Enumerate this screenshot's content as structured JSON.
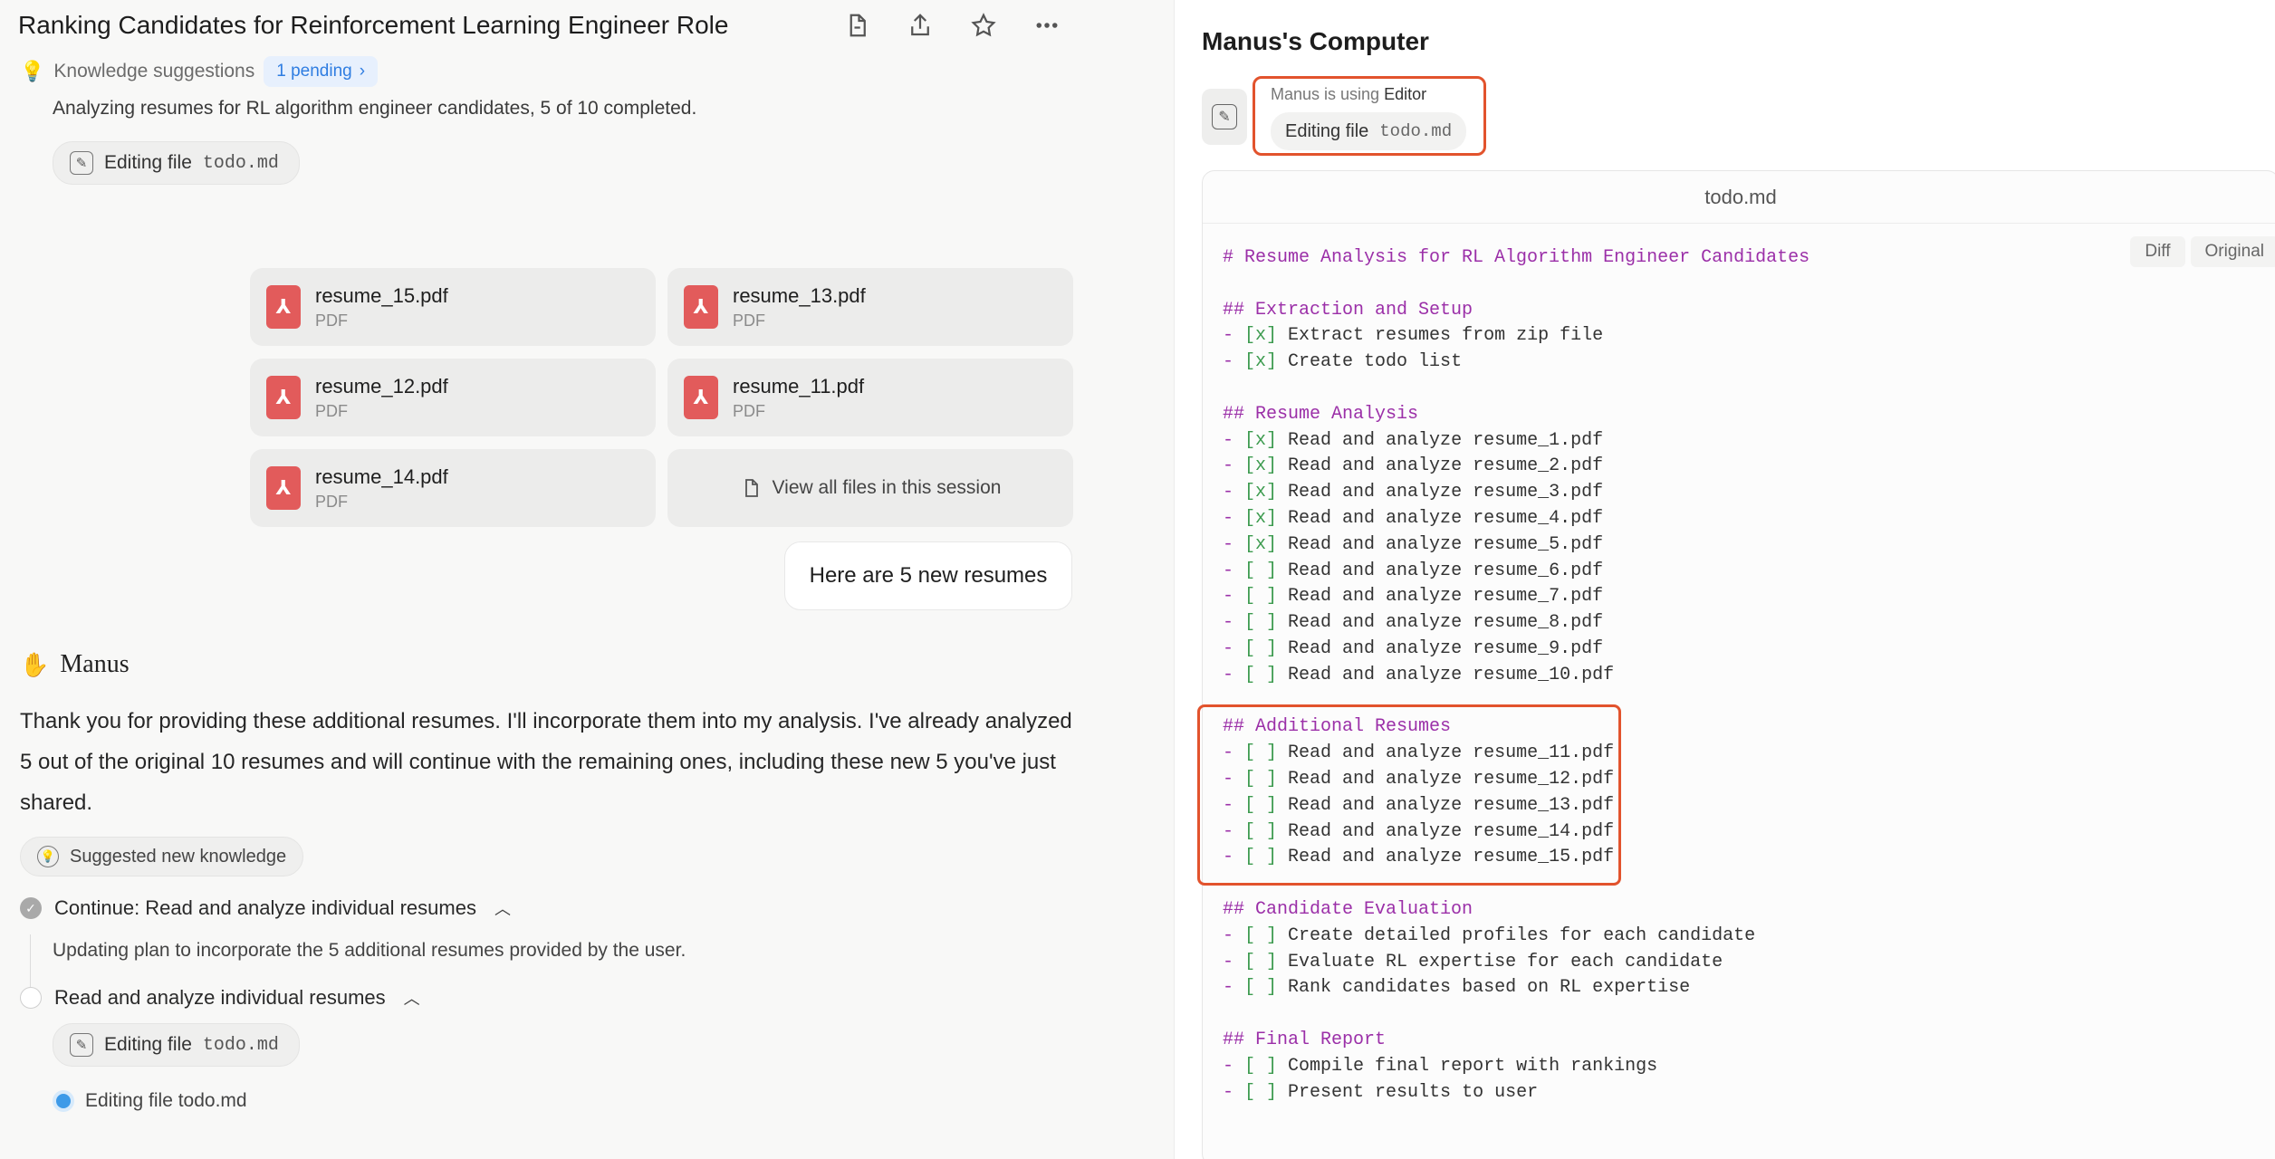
{
  "header": {
    "title": "Ranking Candidates for Reinforcement Learning Engineer Role"
  },
  "knowledge": {
    "label": "Knowledge suggestions",
    "pending": "1 pending"
  },
  "status": "Analyzing resumes for RL algorithm engineer candidates, 5 of 10 completed.",
  "edit_chip_1": {
    "label": "Editing file",
    "file": "todo.md"
  },
  "files": [
    {
      "name": "resume_15.pdf",
      "type": "PDF"
    },
    {
      "name": "resume_13.pdf",
      "type": "PDF"
    },
    {
      "name": "resume_12.pdf",
      "type": "PDF"
    },
    {
      "name": "resume_11.pdf",
      "type": "PDF"
    },
    {
      "name": "resume_14.pdf",
      "type": "PDF"
    }
  ],
  "view_all_label": "View all files in this session",
  "user_message": "Here are 5 new resumes",
  "agent": {
    "name": "Manus",
    "message": "Thank you for providing these additional resumes. I'll incorporate them into my analysis. I've already analyzed 5 out of the original 10 resumes and will continue with the remaining ones, including these new 5 you've just shared.",
    "suggest_label": "Suggested new knowledge"
  },
  "steps": {
    "step1": {
      "label": "Continue: Read and analyze individual resumes",
      "detail": "Updating plan to incorporate the 5 additional resumes provided by the user."
    },
    "step2": {
      "label": "Read and analyze individual resumes"
    },
    "edit_chip_2": {
      "label": "Editing file",
      "file": "todo.md"
    },
    "live": "Editing file todo.md"
  },
  "computer": {
    "title": "Manus's Computer",
    "using_prefix": "Manus is using",
    "using_tool": "Editor",
    "chip_label": "Editing file",
    "chip_file": "todo.md",
    "editor_filename": "todo.md",
    "diff_label": "Diff",
    "original_label": "Original"
  },
  "code": {
    "title": "# Resume Analysis for RL Algorithm Engineer Candidates",
    "sections": [
      {
        "heading": "## Extraction and Setup",
        "items": [
          {
            "box": "[x]",
            "text": "Extract resumes from zip file"
          },
          {
            "box": "[x]",
            "text": "Create todo list"
          }
        ]
      },
      {
        "heading": "## Resume Analysis",
        "items": [
          {
            "box": "[x]",
            "text": "Read and analyze resume_1.pdf"
          },
          {
            "box": "[x]",
            "text": "Read and analyze resume_2.pdf"
          },
          {
            "box": "[x]",
            "text": "Read and analyze resume_3.pdf"
          },
          {
            "box": "[x]",
            "text": "Read and analyze resume_4.pdf"
          },
          {
            "box": "[x]",
            "text": "Read and analyze resume_5.pdf"
          },
          {
            "box": "[ ]",
            "text": "Read and analyze resume_6.pdf"
          },
          {
            "box": "[ ]",
            "text": "Read and analyze resume_7.pdf"
          },
          {
            "box": "[ ]",
            "text": "Read and analyze resume_8.pdf"
          },
          {
            "box": "[ ]",
            "text": "Read and analyze resume_9.pdf"
          },
          {
            "box": "[ ]",
            "text": "Read and analyze resume_10.pdf"
          }
        ]
      },
      {
        "heading": "## Additional Resumes",
        "items": [
          {
            "box": "[ ]",
            "text": "Read and analyze resume_11.pdf"
          },
          {
            "box": "[ ]",
            "text": "Read and analyze resume_12.pdf"
          },
          {
            "box": "[ ]",
            "text": "Read and analyze resume_13.pdf"
          },
          {
            "box": "[ ]",
            "text": "Read and analyze resume_14.pdf"
          },
          {
            "box": "[ ]",
            "text": "Read and analyze resume_15.pdf"
          }
        ]
      },
      {
        "heading": "## Candidate Evaluation",
        "items": [
          {
            "box": "[ ]",
            "text": "Create detailed profiles for each candidate"
          },
          {
            "box": "[ ]",
            "text": "Evaluate RL expertise for each candidate"
          },
          {
            "box": "[ ]",
            "text": "Rank candidates based on RL expertise"
          }
        ]
      },
      {
        "heading": "## Final Report",
        "items": [
          {
            "box": "[ ]",
            "text": "Compile final report with rankings"
          },
          {
            "box": "[ ]",
            "text": "Present results to user"
          }
        ]
      }
    ]
  },
  "colors": {
    "highlight": "#e2532d",
    "heading": "#9b2fa8",
    "checkbox": "#3d9b4f",
    "pdf": "#e25b5b",
    "accent": "#2f7de1"
  }
}
